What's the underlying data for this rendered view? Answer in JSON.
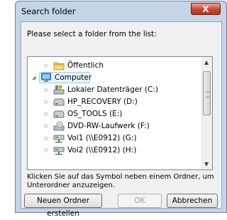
{
  "window": {
    "title": "Search folder",
    "close_glyph": "X"
  },
  "prompt": "Please select a folder from the list:",
  "tree": [
    {
      "label": "Öffentlich",
      "icon": "folder-icon",
      "arrow": "▷",
      "level": 1
    },
    {
      "label": "Computer",
      "icon": "computer-icon",
      "arrow": "◢",
      "level": 0,
      "selected": true
    },
    {
      "label": "Lokaler Datenträger (C:)",
      "icon": "windows-drive-icon",
      "arrow": "▷",
      "level": 1
    },
    {
      "label": "HP_RECOVERY (D:)",
      "icon": "drive-icon",
      "arrow": "▷",
      "level": 1
    },
    {
      "label": "OS_TOOLS (E:)",
      "icon": "drive-icon",
      "arrow": "▷",
      "level": 1
    },
    {
      "label": "DVD-RW-Laufwerk (F:)",
      "icon": "dvd-drive-icon",
      "arrow": "▷",
      "level": 1
    },
    {
      "label": "Vol1 (\\\\E0912) (G:)",
      "icon": "network-drive-icon",
      "arrow": "▷",
      "level": 1
    },
    {
      "label": "Vol2 (\\\\E0912) (H:)",
      "icon": "network-drive-icon",
      "arrow": "▷",
      "level": 1
    }
  ],
  "hint": "Klicken Sie auf das Symbol neben einem Ordner, um Unterordner anzuzeigen.",
  "buttons": {
    "new_folder": "Neuen Ordner erstellen",
    "ok": "OK",
    "cancel": "Abbrechen"
  }
}
